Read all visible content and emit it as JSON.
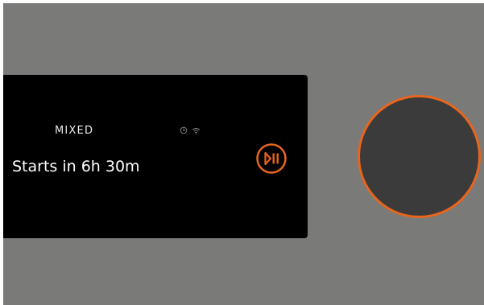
{
  "display": {
    "mode_label": "MIXED",
    "status_text": "Starts in 6h 30m",
    "status_icons": [
      "timer-icon",
      "wifi-icon"
    ]
  },
  "controls": {
    "play_pause_icon": "play-pause-icon",
    "knob_icon": "rotary-dial"
  },
  "colors": {
    "accent": "#e8651e",
    "panel_background": "#7a7a79",
    "screen_background": "#000000",
    "knob_background": "#3b3b3b"
  }
}
